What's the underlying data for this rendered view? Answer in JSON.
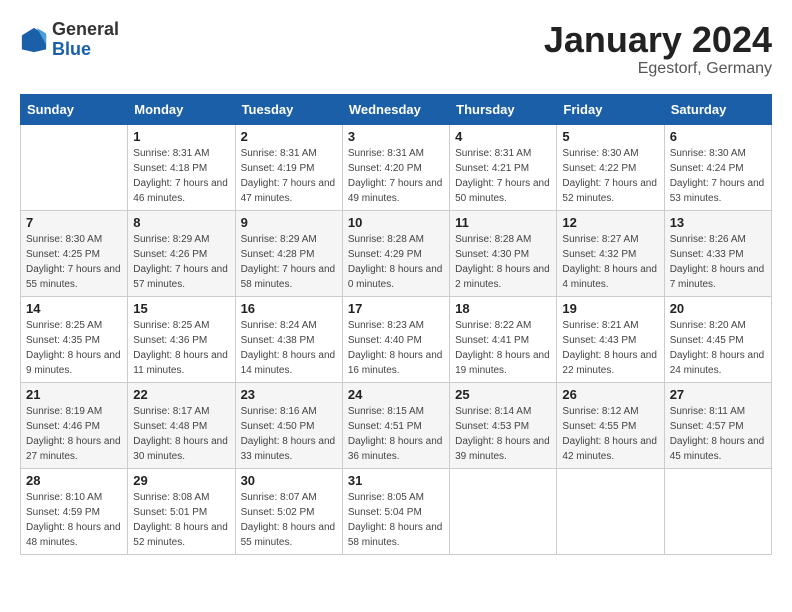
{
  "header": {
    "logo_general": "General",
    "logo_blue": "Blue",
    "month_title": "January 2024",
    "location": "Egestorf, Germany"
  },
  "days_of_week": [
    "Sunday",
    "Monday",
    "Tuesday",
    "Wednesday",
    "Thursday",
    "Friday",
    "Saturday"
  ],
  "weeks": [
    [
      {
        "day": "",
        "sunrise": "",
        "sunset": "",
        "daylight": ""
      },
      {
        "day": "1",
        "sunrise": "Sunrise: 8:31 AM",
        "sunset": "Sunset: 4:18 PM",
        "daylight": "Daylight: 7 hours and 46 minutes."
      },
      {
        "day": "2",
        "sunrise": "Sunrise: 8:31 AM",
        "sunset": "Sunset: 4:19 PM",
        "daylight": "Daylight: 7 hours and 47 minutes."
      },
      {
        "day": "3",
        "sunrise": "Sunrise: 8:31 AM",
        "sunset": "Sunset: 4:20 PM",
        "daylight": "Daylight: 7 hours and 49 minutes."
      },
      {
        "day": "4",
        "sunrise": "Sunrise: 8:31 AM",
        "sunset": "Sunset: 4:21 PM",
        "daylight": "Daylight: 7 hours and 50 minutes."
      },
      {
        "day": "5",
        "sunrise": "Sunrise: 8:30 AM",
        "sunset": "Sunset: 4:22 PM",
        "daylight": "Daylight: 7 hours and 52 minutes."
      },
      {
        "day": "6",
        "sunrise": "Sunrise: 8:30 AM",
        "sunset": "Sunset: 4:24 PM",
        "daylight": "Daylight: 7 hours and 53 minutes."
      }
    ],
    [
      {
        "day": "7",
        "sunrise": "Sunrise: 8:30 AM",
        "sunset": "Sunset: 4:25 PM",
        "daylight": "Daylight: 7 hours and 55 minutes."
      },
      {
        "day": "8",
        "sunrise": "Sunrise: 8:29 AM",
        "sunset": "Sunset: 4:26 PM",
        "daylight": "Daylight: 7 hours and 57 minutes."
      },
      {
        "day": "9",
        "sunrise": "Sunrise: 8:29 AM",
        "sunset": "Sunset: 4:28 PM",
        "daylight": "Daylight: 7 hours and 58 minutes."
      },
      {
        "day": "10",
        "sunrise": "Sunrise: 8:28 AM",
        "sunset": "Sunset: 4:29 PM",
        "daylight": "Daylight: 8 hours and 0 minutes."
      },
      {
        "day": "11",
        "sunrise": "Sunrise: 8:28 AM",
        "sunset": "Sunset: 4:30 PM",
        "daylight": "Daylight: 8 hours and 2 minutes."
      },
      {
        "day": "12",
        "sunrise": "Sunrise: 8:27 AM",
        "sunset": "Sunset: 4:32 PM",
        "daylight": "Daylight: 8 hours and 4 minutes."
      },
      {
        "day": "13",
        "sunrise": "Sunrise: 8:26 AM",
        "sunset": "Sunset: 4:33 PM",
        "daylight": "Daylight: 8 hours and 7 minutes."
      }
    ],
    [
      {
        "day": "14",
        "sunrise": "Sunrise: 8:25 AM",
        "sunset": "Sunset: 4:35 PM",
        "daylight": "Daylight: 8 hours and 9 minutes."
      },
      {
        "day": "15",
        "sunrise": "Sunrise: 8:25 AM",
        "sunset": "Sunset: 4:36 PM",
        "daylight": "Daylight: 8 hours and 11 minutes."
      },
      {
        "day": "16",
        "sunrise": "Sunrise: 8:24 AM",
        "sunset": "Sunset: 4:38 PM",
        "daylight": "Daylight: 8 hours and 14 minutes."
      },
      {
        "day": "17",
        "sunrise": "Sunrise: 8:23 AM",
        "sunset": "Sunset: 4:40 PM",
        "daylight": "Daylight: 8 hours and 16 minutes."
      },
      {
        "day": "18",
        "sunrise": "Sunrise: 8:22 AM",
        "sunset": "Sunset: 4:41 PM",
        "daylight": "Daylight: 8 hours and 19 minutes."
      },
      {
        "day": "19",
        "sunrise": "Sunrise: 8:21 AM",
        "sunset": "Sunset: 4:43 PM",
        "daylight": "Daylight: 8 hours and 22 minutes."
      },
      {
        "day": "20",
        "sunrise": "Sunrise: 8:20 AM",
        "sunset": "Sunset: 4:45 PM",
        "daylight": "Daylight: 8 hours and 24 minutes."
      }
    ],
    [
      {
        "day": "21",
        "sunrise": "Sunrise: 8:19 AM",
        "sunset": "Sunset: 4:46 PM",
        "daylight": "Daylight: 8 hours and 27 minutes."
      },
      {
        "day": "22",
        "sunrise": "Sunrise: 8:17 AM",
        "sunset": "Sunset: 4:48 PM",
        "daylight": "Daylight: 8 hours and 30 minutes."
      },
      {
        "day": "23",
        "sunrise": "Sunrise: 8:16 AM",
        "sunset": "Sunset: 4:50 PM",
        "daylight": "Daylight: 8 hours and 33 minutes."
      },
      {
        "day": "24",
        "sunrise": "Sunrise: 8:15 AM",
        "sunset": "Sunset: 4:51 PM",
        "daylight": "Daylight: 8 hours and 36 minutes."
      },
      {
        "day": "25",
        "sunrise": "Sunrise: 8:14 AM",
        "sunset": "Sunset: 4:53 PM",
        "daylight": "Daylight: 8 hours and 39 minutes."
      },
      {
        "day": "26",
        "sunrise": "Sunrise: 8:12 AM",
        "sunset": "Sunset: 4:55 PM",
        "daylight": "Daylight: 8 hours and 42 minutes."
      },
      {
        "day": "27",
        "sunrise": "Sunrise: 8:11 AM",
        "sunset": "Sunset: 4:57 PM",
        "daylight": "Daylight: 8 hours and 45 minutes."
      }
    ],
    [
      {
        "day": "28",
        "sunrise": "Sunrise: 8:10 AM",
        "sunset": "Sunset: 4:59 PM",
        "daylight": "Daylight: 8 hours and 48 minutes."
      },
      {
        "day": "29",
        "sunrise": "Sunrise: 8:08 AM",
        "sunset": "Sunset: 5:01 PM",
        "daylight": "Daylight: 8 hours and 52 minutes."
      },
      {
        "day": "30",
        "sunrise": "Sunrise: 8:07 AM",
        "sunset": "Sunset: 5:02 PM",
        "daylight": "Daylight: 8 hours and 55 minutes."
      },
      {
        "day": "31",
        "sunrise": "Sunrise: 8:05 AM",
        "sunset": "Sunset: 5:04 PM",
        "daylight": "Daylight: 8 hours and 58 minutes."
      },
      {
        "day": "",
        "sunrise": "",
        "sunset": "",
        "daylight": ""
      },
      {
        "day": "",
        "sunrise": "",
        "sunset": "",
        "daylight": ""
      },
      {
        "day": "",
        "sunrise": "",
        "sunset": "",
        "daylight": ""
      }
    ]
  ]
}
